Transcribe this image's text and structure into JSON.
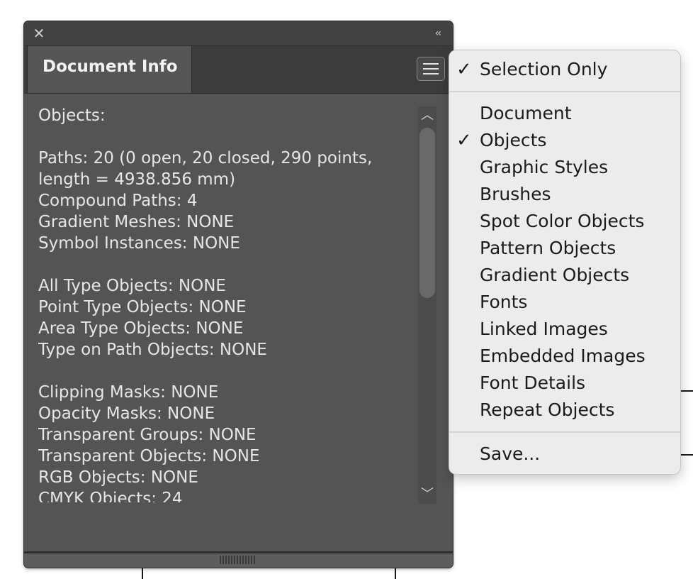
{
  "panel": {
    "tab_label": "Document Info",
    "close_glyph": "✕",
    "collapse_glyph": "‹‹",
    "menu_icon": "hamburger-menu-icon",
    "scroll_up_glyph": "︿",
    "scroll_down_glyph": "﹀",
    "lines": [
      "Objects:",
      "",
      "Paths: 20 (0 open, 20 closed, 290 points, length = 4938.856 mm)",
      "Compound Paths: 4",
      "Gradient Meshes: NONE",
      "Symbol Instances: NONE",
      "",
      "All Type Objects: NONE",
      "Point Type Objects: NONE",
      "Area Type Objects: NONE",
      "Type on Path Objects: NONE",
      "",
      "Clipping Masks: NONE",
      "Opacity Masks: NONE",
      "Transparent Groups: NONE",
      "Transparent Objects: NONE",
      "RGB Objects: NONE",
      "CMYK Objects: 24"
    ]
  },
  "dropdown": {
    "check_glyph": "✓",
    "items": [
      {
        "label": "Selection Only",
        "checked": true
      },
      {
        "label": "Document",
        "checked": false
      },
      {
        "label": "Objects",
        "checked": true
      },
      {
        "label": "Graphic Styles",
        "checked": false
      },
      {
        "label": "Brushes",
        "checked": false
      },
      {
        "label": "Spot Color Objects",
        "checked": false
      },
      {
        "label": "Pattern Objects",
        "checked": false
      },
      {
        "label": "Gradient Objects",
        "checked": false
      },
      {
        "label": "Fonts",
        "checked": false
      },
      {
        "label": "Linked Images",
        "checked": false
      },
      {
        "label": "Embedded Images",
        "checked": false
      },
      {
        "label": "Font Details",
        "checked": false
      },
      {
        "label": "Repeat Objects",
        "checked": false
      },
      {
        "label": "Save...",
        "checked": false
      }
    ]
  }
}
